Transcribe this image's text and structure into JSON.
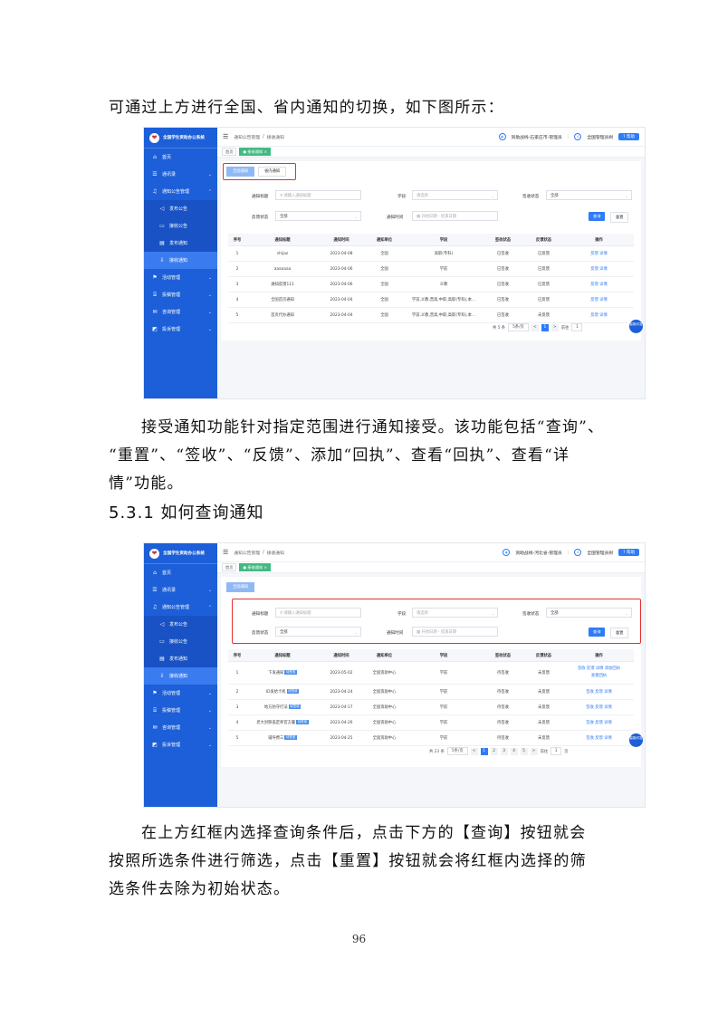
{
  "intro_line": "可通过上方进行全国、省内通知的切换，如下图所示：",
  "paragraph2_lines": [
    "接受通知功能针对指定范围进行通知接受。该功能包括“查询”、",
    "“重置”、“签收”、“反馈”、添加“回执”、查看“回执”、查看“详",
    "情”功能。"
  ],
  "section_heading": "5.3.1 如何查询通知",
  "paragraph3_lines": [
    "在上方红框内选择查询条件后，点击下方的【查询】按钮就会",
    "按照所选条件进行筛选，点击【重置】按钮就会将红框内选择的筛",
    "选条件去除为初始状态。"
  ],
  "page_number": "96",
  "app": {
    "brand": "全国学生资助办公系统",
    "menu_toggle": "☰",
    "breadcrumb_home": "通知公告管理",
    "breadcrumb_sep": "/",
    "breadcrumb_current": "接收通知",
    "tag_home": "首页",
    "tag_current": "● 接收通知 ×",
    "help_btn": "? 帮助",
    "shot1_org": "资助战线-石家庄市-管理员",
    "shot1_user": "全国管理员树",
    "shot2_org": "资助战线-河北省-管理员",
    "shot2_user": "全国管理员树",
    "menu": [
      {
        "icon": "⌂",
        "label": "首页",
        "chev": ""
      },
      {
        "icon": "☰",
        "label": "通讯录",
        "chev": "⌄"
      },
      {
        "icon": "♫",
        "label": "通知公告管理",
        "chev": "⌃"
      }
    ],
    "submenu": [
      {
        "icon": "◁",
        "label": "发布公告"
      },
      {
        "icon": "▭",
        "label": "接收公告"
      },
      {
        "icon": "▤",
        "label": "发布通知"
      },
      {
        "icon": "⇩",
        "label": "接收通知"
      }
    ],
    "menu_bottom": [
      {
        "icon": "⚑",
        "label": "活动管理"
      },
      {
        "icon": "⌸",
        "label": "投稿管理"
      },
      {
        "icon": "✉",
        "label": "咨询管理"
      },
      {
        "icon": "◩",
        "label": "投诉管理"
      }
    ],
    "switch_national": "全国通知",
    "switch_province": "省内通知",
    "filter_title_label": "通知标题",
    "filter_title_placeholder": "请输入通知标题",
    "filter_stage_label": "学段",
    "filter_stage_placeholder": "请选择",
    "filter_sign_label": "签收状态",
    "filter_sign_value": "全部",
    "filter_feedback_label": "反馈状态",
    "filter_feedback_value": "全部",
    "filter_time_label": "通知时间",
    "filter_time_start": "开始日期",
    "filter_time_sep": "-",
    "filter_time_end": "结束日期",
    "btn_query": "查询",
    "btn_reset": "重置",
    "columns": [
      "序号",
      "通知标题",
      "通知时间",
      "通知单位",
      "学段",
      "签收状态",
      "反馈状态",
      "操作"
    ],
    "float_help": "智能问答"
  },
  "table1": [
    {
      "no": "1",
      "title": "shijaz",
      "time": "2023-04-08",
      "unit": "全国",
      "stage": "高职(专科)",
      "sign": "已签收",
      "feedback": "已反馈",
      "op": "反馈  详情"
    },
    {
      "no": "2",
      "title": "aaaaaaa",
      "time": "2023-04-06",
      "unit": "全国",
      "stage": "学前",
      "sign": "已签收",
      "feedback": "已反馈",
      "op": "反馈  详情"
    },
    {
      "no": "3",
      "title": "通知反馈111",
      "time": "2023-04-06",
      "unit": "全国",
      "stage": "义教",
      "sign": "已签收",
      "feedback": "已反馈",
      "op": "反馈  详情"
    },
    {
      "no": "4",
      "title": "全国首页通知",
      "time": "2023-04-04",
      "unit": "全国",
      "stage": "学前,义教,普高,中职,高职(专科),本...",
      "sign": "已签收",
      "feedback": "已反馈",
      "op": "反馈  详情"
    },
    {
      "no": "5",
      "title": "首页代办通知",
      "time": "2023-04-04",
      "unit": "全国",
      "stage": "学前,义教,普高,中职,高职(专科),本...",
      "sign": "已签收",
      "feedback": "未反馈",
      "op": "反馈  详情"
    }
  ],
  "pager1": {
    "total": "共 5 条",
    "size": "5条/页",
    "prev": "<",
    "page": "1",
    "next": ">",
    "goto": "前往",
    "jump": "1"
  },
  "table2": [
    {
      "no": "1",
      "title": "下发通知",
      "badge": "待签收",
      "time": "2023-05-02",
      "unit": "全国资助中心",
      "stage": "学前",
      "sign": "待签收",
      "feedback": "未反馈",
      "op": "签收  反馈  详情  添加回执",
      "op2": "查看回执"
    },
    {
      "no": "2",
      "title": "ID发给卡机",
      "badge": "待签收",
      "time": "2023-04-24",
      "unit": "全国资助中心",
      "stage": "学前",
      "sign": "待签收",
      "feedback": "未反馈",
      "op": "签收  反馈  详情",
      "op2": ""
    },
    {
      "no": "3",
      "title": "地方防守打法",
      "badge": "待签收",
      "time": "2023-04-17",
      "unit": "全国资助中心",
      "stage": "学前",
      "sign": "待签收",
      "feedback": "未反馈",
      "op": "签收  反馈  详情",
      "op2": ""
    },
    {
      "no": "4",
      "title": "老大封肺盖定师官方量",
      "badge": "待签收",
      "time": "2023-04-26",
      "unit": "全国资助中心",
      "stage": "学前",
      "sign": "待签收",
      "feedback": "未反馈",
      "op": "签收  反馈  详情",
      "op2": ""
    },
    {
      "no": "5",
      "title": "辅导费三",
      "badge": "待签收",
      "time": "2023-04-25",
      "unit": "全国资助中心",
      "stage": "学前",
      "sign": "待签收",
      "feedback": "未反馈",
      "op": "签收  反馈  详情",
      "op2": ""
    }
  ],
  "pager2": {
    "total": "共 23 条",
    "size": "5条/页",
    "prev": "<",
    "pages": [
      "1",
      "2",
      "3",
      "4",
      "5"
    ],
    "next": ">",
    "goto": "前往",
    "jump": "1",
    "unit": "页"
  }
}
